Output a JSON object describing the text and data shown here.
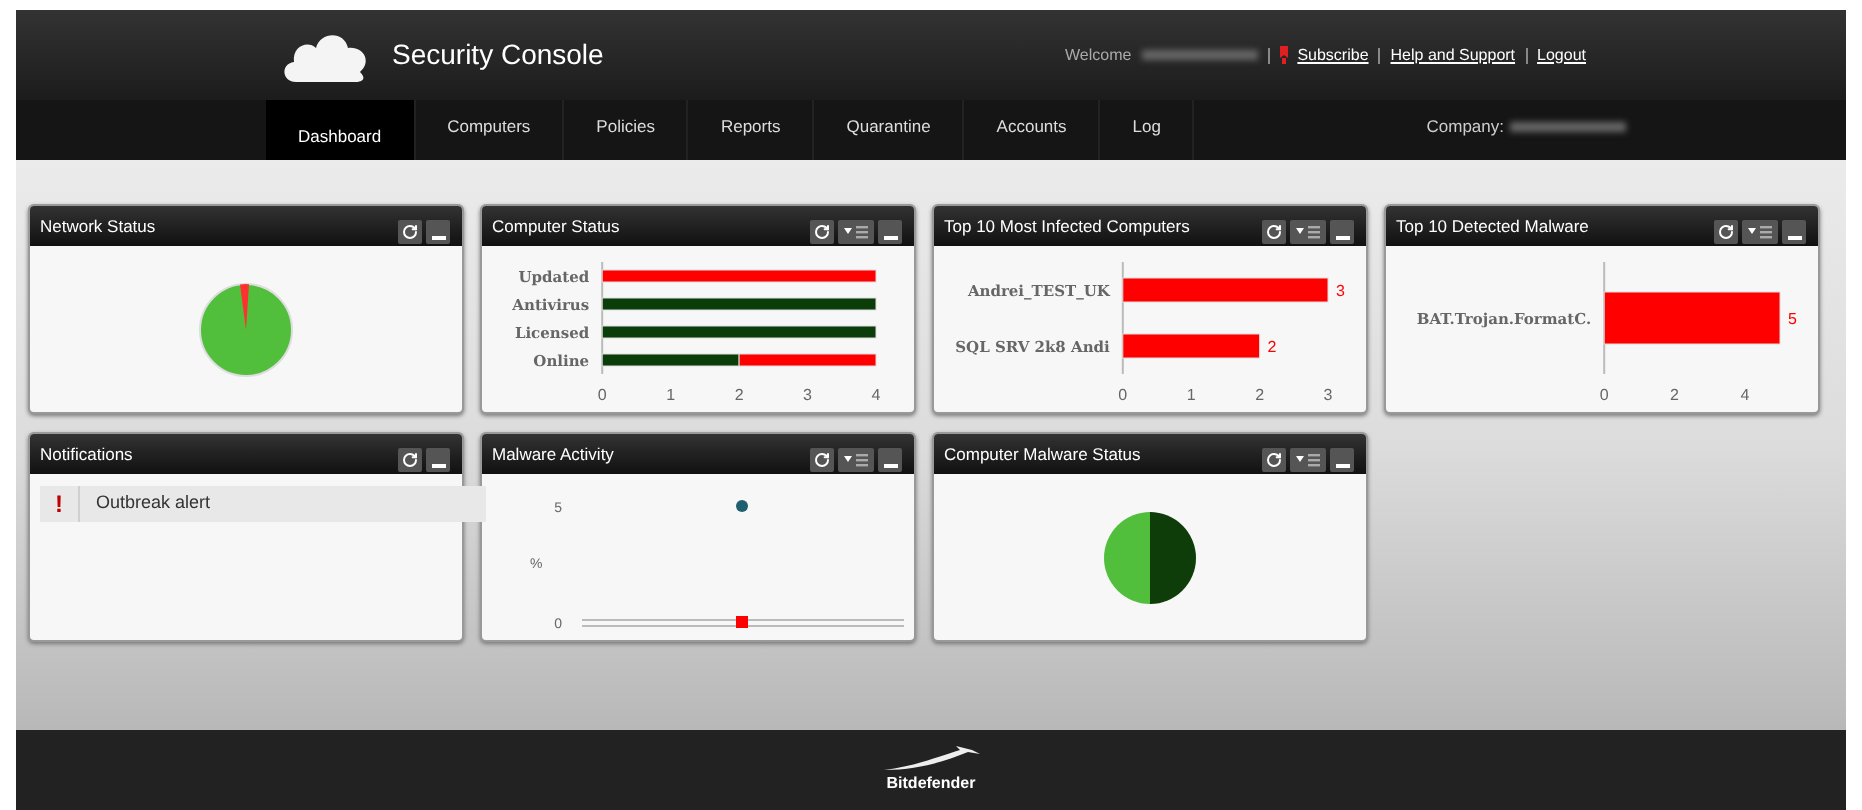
{
  "header": {
    "title": "Security Console",
    "welcome": "Welcome",
    "links": [
      "Subscribe",
      "Help and Support",
      "Logout"
    ]
  },
  "nav": {
    "tabs": [
      {
        "label": "Dashboard",
        "selected": true
      },
      {
        "label": "Computers",
        "selected": false
      },
      {
        "label": "Policies",
        "selected": false
      },
      {
        "label": "Reports",
        "selected": false
      },
      {
        "label": "Quarantine",
        "selected": false
      },
      {
        "label": "Accounts",
        "selected": false
      },
      {
        "label": "Log",
        "selected": false
      }
    ],
    "company_label": "Company:"
  },
  "widgets": [
    {
      "title": "Network Status",
      "menu": false,
      "kind": "pie"
    },
    {
      "title": "Computer Status",
      "menu": true,
      "kind": "bars",
      "chart_data": {
        "type": "bar",
        "orientation": "horizontal",
        "stacked": true,
        "categories": [
          "Updated",
          "Antivirus",
          "Licensed",
          "Online"
        ],
        "series": [
          {
            "color": "#0b3d0b",
            "values": [
              0,
              4,
              4,
              2
            ]
          },
          {
            "color": "#ff0000",
            "values": [
              4,
              0,
              0,
              2
            ]
          }
        ],
        "xticks": [
          0,
          1,
          2,
          3,
          4
        ],
        "xlim": [
          0,
          4
        ]
      }
    },
    {
      "title": "Top 10 Most Infected Computers",
      "menu": true,
      "kind": "bars",
      "chart_data": {
        "type": "bar",
        "orientation": "horizontal",
        "categories": [
          "Andrei_TEST_UK",
          "SQL SRV 2k8 Andi"
        ],
        "series": [
          {
            "color": "#ff0000",
            "values": [
              3,
              2
            ]
          }
        ],
        "xticks": [
          0,
          1,
          2,
          3
        ],
        "xlim": [
          0,
          3
        ],
        "data_labels": true
      }
    },
    {
      "title": "Top 10 Detected Malware",
      "menu": true,
      "kind": "bars",
      "chart_data": {
        "type": "bar",
        "orientation": "horizontal",
        "categories": [
          "BAT.Trojan.FormatC."
        ],
        "series": [
          {
            "color": "#ff0000",
            "values": [
              5
            ]
          }
        ],
        "xticks": [
          0,
          2,
          4
        ],
        "xlim": [
          0,
          5
        ],
        "data_labels": true
      }
    },
    {
      "title": "Notifications",
      "menu": false,
      "kind": "list",
      "items": [
        {
          "icon": "!",
          "label": "Outbreak alert"
        }
      ]
    },
    {
      "title": "Malware Activity",
      "menu": true,
      "kind": "activity",
      "chart_data": {
        "type": "scatter",
        "ylabel": "%",
        "yticks": [
          0,
          5
        ],
        "ylim": [
          0,
          5
        ],
        "series": [
          {
            "color": "#1f5f6f",
            "values": [
              5
            ]
          },
          {
            "color": "#ff0000",
            "values": [
              0
            ]
          }
        ]
      }
    },
    {
      "title": "Computer Malware Status",
      "menu": true,
      "kind": "half-pie"
    }
  ],
  "footer": {
    "brand": "Bitdefender"
  }
}
